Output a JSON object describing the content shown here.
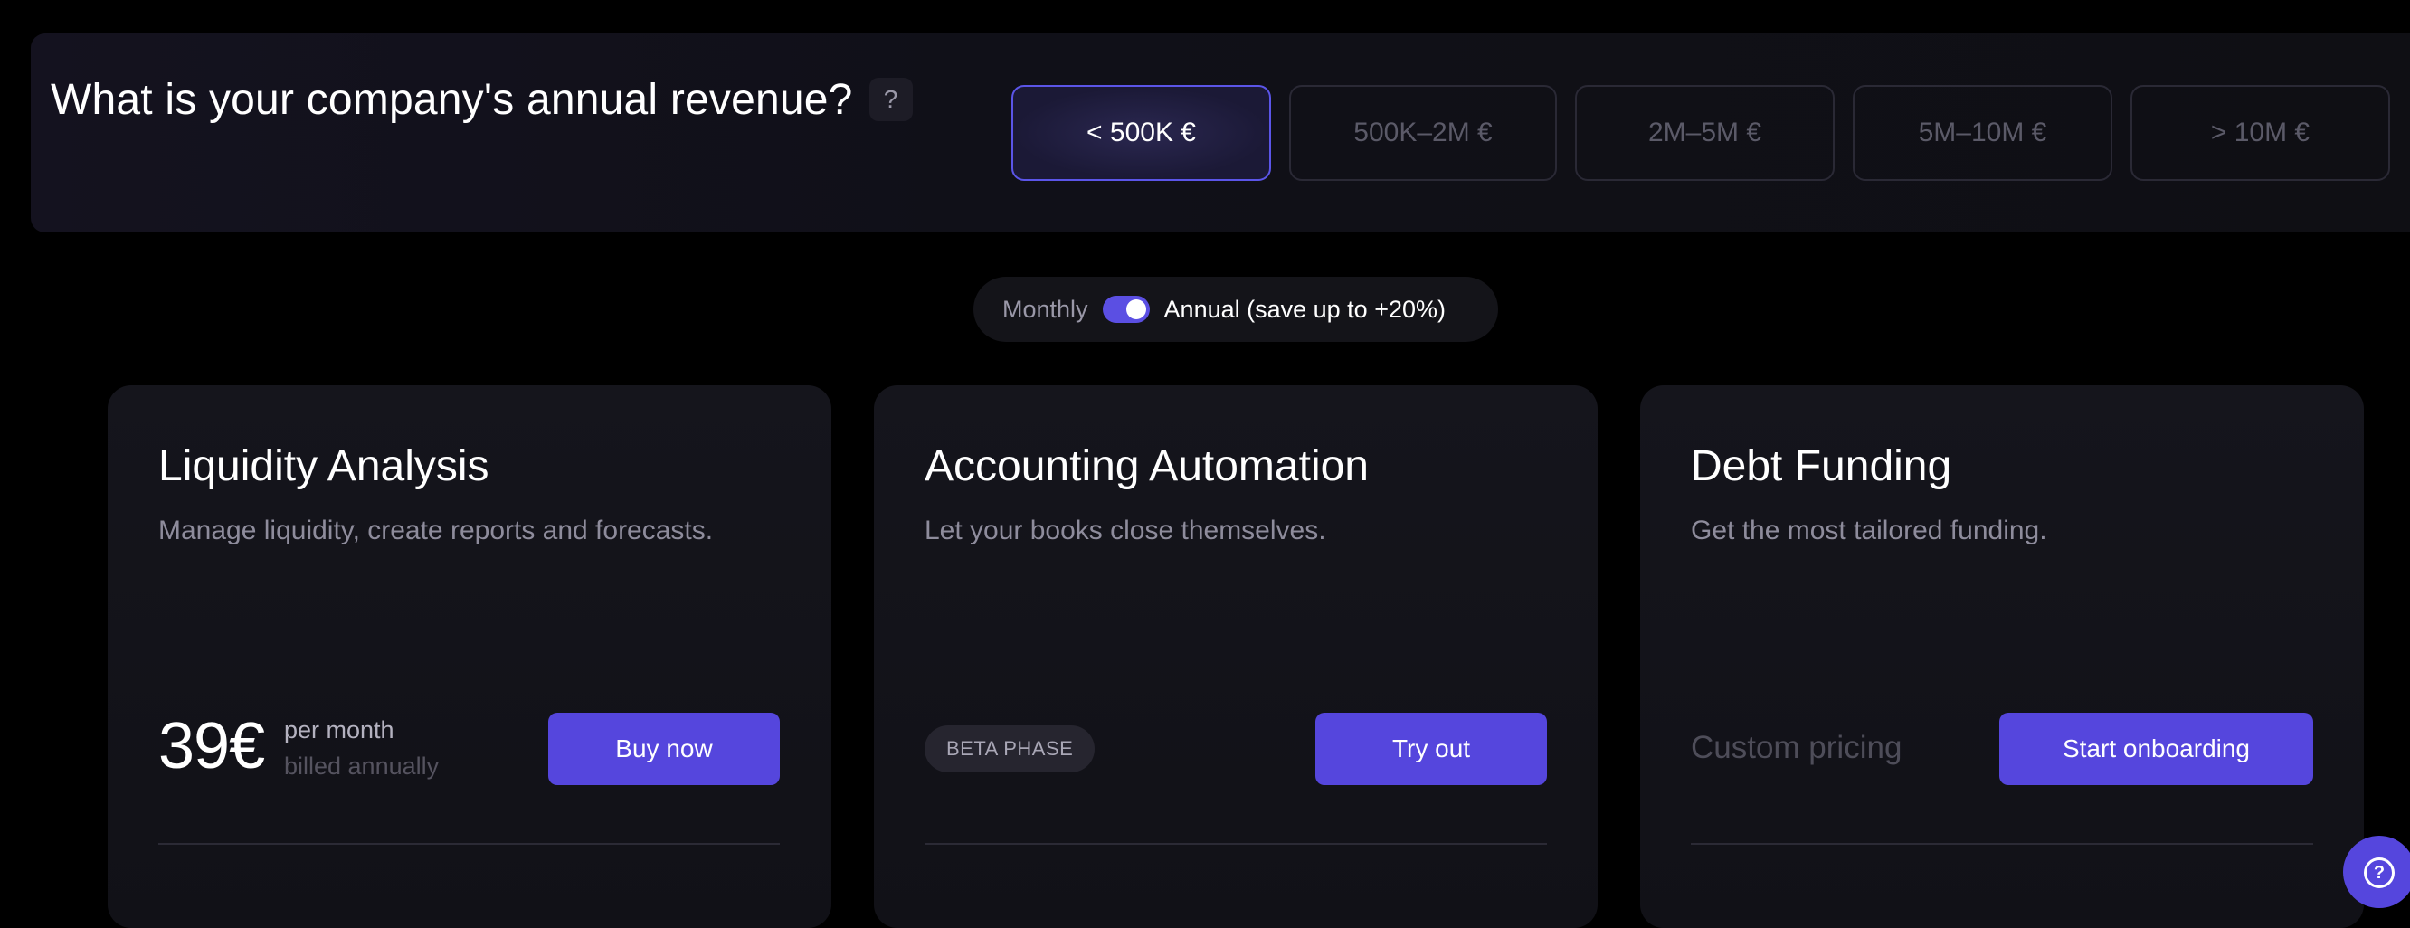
{
  "revenue": {
    "question": "What is your company's annual revenue?",
    "help_icon": "?",
    "options": [
      {
        "label": "< 500K €",
        "selected": true
      },
      {
        "label": "500K–2M €",
        "selected": false
      },
      {
        "label": "2M–5M €",
        "selected": false
      },
      {
        "label": "5M–10M €",
        "selected": false
      },
      {
        "label": "> 10M €",
        "selected": false
      }
    ]
  },
  "billing_toggle": {
    "monthly_label": "Monthly",
    "annual_label": "Annual (save up to +20%)",
    "annual_selected": true
  },
  "cards": [
    {
      "title": "Liquidity Analysis",
      "description": "Manage liquidity, create reports and forecasts.",
      "price": "39€",
      "price_period": "per month",
      "price_billing": "billed annually",
      "cta": "Buy now"
    },
    {
      "title": "Accounting Automation",
      "description": "Let your books close themselves.",
      "badge": "BETA PHASE",
      "cta": "Try out"
    },
    {
      "title": "Debt Funding",
      "description": "Get the most tailored funding.",
      "pricing_note": "Custom pricing",
      "cta": "Start onboarding"
    }
  ],
  "help_fab": {
    "icon": "?"
  },
  "colors": {
    "accent": "#5546dd",
    "background": "#000000",
    "card": "#15151c",
    "selected_border": "#5b55e8"
  }
}
